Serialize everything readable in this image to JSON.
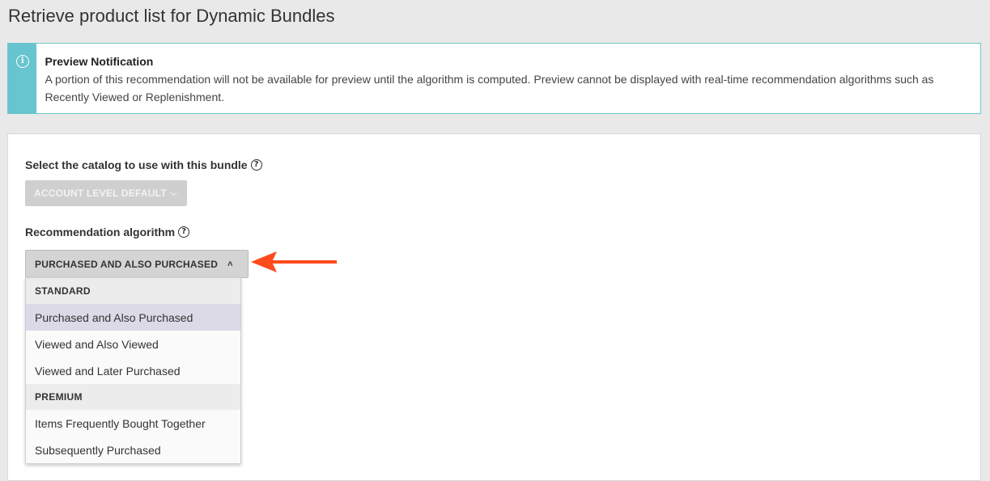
{
  "page": {
    "title": "Retrieve product list for Dynamic Bundles"
  },
  "notification": {
    "title": "Preview Notification",
    "text": "A portion of this recommendation will not be available for preview until the algorithm is computed. Preview cannot be displayed with real-time recommendation algorithms such as Recently Viewed or Replenishment.",
    "icon": "info-icon",
    "accent_color": "#66c5cf"
  },
  "catalog": {
    "label": "Select the catalog to use with this bundle",
    "button_label": "ACCOUNT LEVEL DEFAULT",
    "disabled": true
  },
  "algorithm": {
    "label": "Recommendation algorithm",
    "selected": "PURCHASED AND ALSO PURCHASED",
    "dropdown_open": true,
    "groups": [
      {
        "label": "STANDARD",
        "items": [
          {
            "label": "Purchased and Also Purchased",
            "selected": true
          },
          {
            "label": "Viewed and Also Viewed",
            "selected": false
          },
          {
            "label": "Viewed and Later Purchased",
            "selected": false
          }
        ]
      },
      {
        "label": "PREMIUM",
        "items": [
          {
            "label": "Items Frequently Bought Together",
            "selected": false
          },
          {
            "label": "Subsequently Purchased",
            "selected": false
          }
        ]
      }
    ]
  },
  "annotation": {
    "icon": "arrow-left-icon",
    "color": "#ff4a1c"
  }
}
